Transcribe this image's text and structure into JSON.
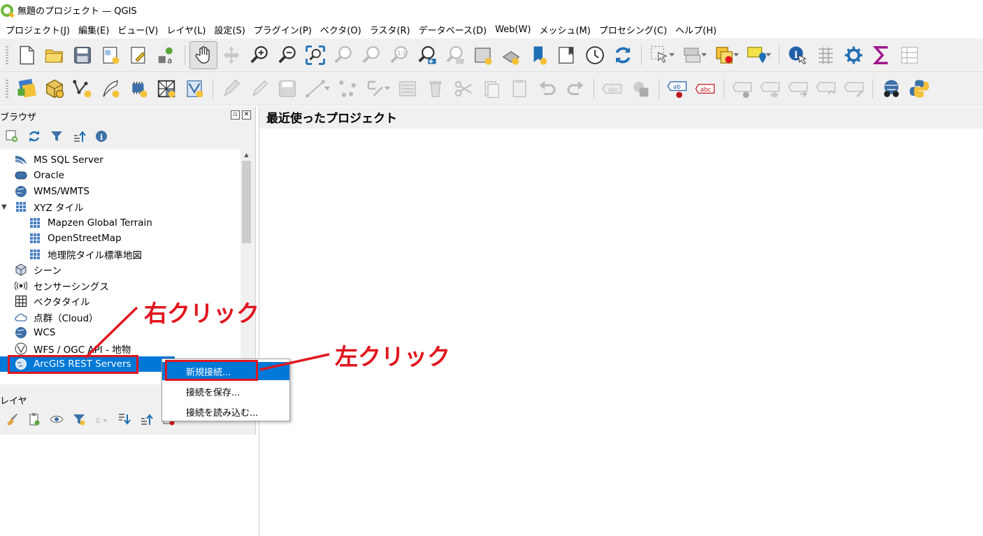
{
  "window": {
    "title": "無題のプロジェクト — QGIS",
    "logo": "qgis-logo"
  },
  "menubar": {
    "items": [
      "プロジェクト(J)",
      "編集(E)",
      "ビュー(V)",
      "レイヤ(L)",
      "設定(S)",
      "プラグイン(P)",
      "ベクタ(O)",
      "ラスタ(R)",
      "データベース(D)",
      "Web(W)",
      "メッシュ(M)",
      "プロセシング(C)",
      "ヘルプ(H)"
    ]
  },
  "toolbar1": {
    "icons": [
      "new-project-icon",
      "open-project-icon",
      "save-project-icon",
      "new-print-layout-icon",
      "layout-manager-icon",
      "style-manager-icon",
      "pan-map-icon",
      "pan-to-selection-icon",
      "zoom-in-icon",
      "zoom-out-icon",
      "zoom-full-icon",
      "zoom-to-selection-icon",
      "zoom-to-layer-icon",
      "zoom-native-icon",
      "zoom-last-icon",
      "zoom-next-icon",
      "new-bookmark-icon",
      "show-bookmarks-icon",
      "spatial-bookmark-icon",
      "map-tips-icon",
      "temporal-controller-icon",
      "refresh-icon",
      "select-features-icon",
      "deselect-icon",
      "select-by-expression-icon",
      "select-by-location-icon",
      "identify-icon",
      "attribute-table-icon",
      "processing-toolbox-icon",
      "statistics-icon",
      "field-calculator-icon"
    ]
  },
  "toolbar2": {
    "icons": [
      "data-source-manager-icon",
      "new-geopackage-icon",
      "new-shapefile-icon",
      "new-scratch-layer-icon",
      "new-virtual-layer-icon",
      "new-mesh-icon",
      "new-spatialite-icon",
      "digitize-icon",
      "toggle-editing-icon",
      "save-edits-icon",
      "add-line-icon",
      "vertex-tool-icon",
      "modify-attributes-icon",
      "delete-selected-icon",
      "cut-features-icon",
      "copy-features-icon",
      "paste-features-icon",
      "undo-icon",
      "redo-icon",
      "label-icon",
      "label-pin-icon",
      "label-highlight-icon",
      "label-rule-icon",
      "label-move-icon",
      "label-show-icon",
      "label-rotate-icon",
      "label-change-icon",
      "label-properties-icon",
      "metasearch-icon",
      "python-console-icon"
    ]
  },
  "browser_panel": {
    "title": "ブラウザ",
    "tools": [
      "add-selected-layers-icon",
      "refresh-icon",
      "filter-icon",
      "collapse-all-icon",
      "properties-icon"
    ],
    "items": [
      {
        "label": "MS SQL Server",
        "icon": "mssql-icon"
      },
      {
        "label": "Oracle",
        "icon": "oracle-icon"
      },
      {
        "label": "WMS/WMTS",
        "icon": "wms-globe-icon"
      },
      {
        "label": "XYZ タイル",
        "icon": "xyz-tiles-icon",
        "expanded": true
      },
      {
        "label": "Mapzen Global Terrain",
        "icon": "xyz-tiles-icon",
        "child": true
      },
      {
        "label": "OpenStreetMap",
        "icon": "xyz-tiles-icon",
        "child": true
      },
      {
        "label": "地理院タイル標準地図",
        "icon": "xyz-tiles-icon",
        "child": true
      },
      {
        "label": "シーン",
        "icon": "scene-cube-icon"
      },
      {
        "label": "センサーシングス",
        "icon": "sensorthings-icon"
      },
      {
        "label": "ベクタタイル",
        "icon": "vector-tiles-icon"
      },
      {
        "label": "点群（Cloud）",
        "icon": "cloud-icon"
      },
      {
        "label": "WCS",
        "icon": "wcs-globe-icon"
      },
      {
        "label": "WFS / OGC API - 地物",
        "icon": "wfs-icon"
      },
      {
        "label": "ArcGIS REST Servers",
        "icon": "arcgis-globe-icon",
        "selected": true
      }
    ]
  },
  "layers_panel": {
    "title": "レイヤ",
    "tools": [
      "layer-style-icon",
      "add-group-icon",
      "manage-visibility-icon",
      "filter-legend-icon",
      "filter-expression-icon",
      "expand-all-icon",
      "collapse-all-icon",
      "remove-layer-icon"
    ]
  },
  "main": {
    "title": "最近使ったプロジェクト"
  },
  "context_menu": {
    "items": [
      {
        "label": "新規接続...",
        "active": true
      },
      {
        "label": "接続を保存..."
      },
      {
        "label": "接続を読み込む..."
      }
    ]
  },
  "annotations": {
    "right_click": "右クリック",
    "left_click": "左クリック",
    "highlight_color": "#e0161e"
  },
  "colors": {
    "selection": "#0078d7",
    "qgis_green": "#6fb83c",
    "qgis_yellow": "#f0b429"
  }
}
